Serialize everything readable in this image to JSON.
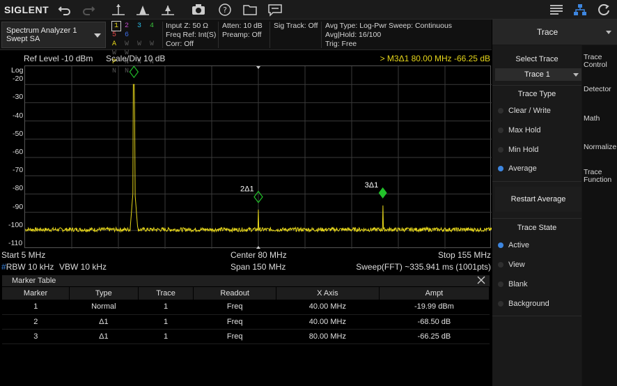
{
  "brand": "SIGLENT",
  "colors": {
    "trace": "#e5d51a",
    "marker": "#22c12a",
    "accent": "#3d86e0"
  },
  "toolbar": {
    "icons": [
      "undo-icon",
      "redo-icon",
      "marker-peak-icon",
      "marker-next-icon",
      "marker-delta-icon",
      "camera-icon",
      "help-icon",
      "folder-icon",
      "message-icon",
      "menu-icon",
      "network-icon",
      "restart-icon"
    ]
  },
  "mode": {
    "line1": "Spectrum Analyzer 1",
    "line2": "Swept SA"
  },
  "traces": {
    "numbers": [
      "1",
      "2",
      "3",
      "4",
      "5",
      "6"
    ],
    "row2": [
      "A",
      "W",
      "W",
      "W",
      "W",
      "W"
    ],
    "row3": [
      "P",
      "N",
      "N",
      "N",
      "N",
      "N"
    ]
  },
  "status": {
    "input_z": "Input Z: 50 Ω",
    "freq_ref": "Freq Ref: Int(S)",
    "corr": "Corr: Off",
    "atten": "Atten: 10 dB",
    "preamp": "Preamp: Off",
    "sig_track": "Sig Track: Off",
    "avg_type": "Avg Type: Log-Pwr",
    "avg_hold": "Avg|Hold: 16/100",
    "trig": "Trig: Free",
    "sweep": "Sweep: Continuous"
  },
  "plot": {
    "ref_level": "Ref Level  -10 dBm",
    "scale": "Scale/Div  10 dB",
    "marker_readout": "> M3Δ1   80.00 MHz  -66.25 dB",
    "y_scale_label": "Log",
    "y_ticks": [
      "-20",
      "-30",
      "-40",
      "-50",
      "-60",
      "-70",
      "-80",
      "-90",
      "-100",
      "-110"
    ],
    "start": "Start  5 MHz",
    "center": "Center  80 MHz",
    "stop": "Stop  155 MHz",
    "rbw": "RBW  10 kHz",
    "vbw": "VBW  10 kHz",
    "span": "Span  150 MHz",
    "sweep_time": "Sweep(FFT)  ~335.941 ms (1001pts)",
    "marker_labels": [
      "1",
      "2Δ1",
      "3Δ1"
    ]
  },
  "chart_data": {
    "type": "line",
    "xlabel": "",
    "ylabel": "",
    "xlim": [
      5,
      155
    ],
    "ylim": [
      -110,
      -10
    ],
    "series": [
      {
        "x": [
          5,
          38.5,
          39.5,
          40,
          40.5,
          41.5,
          80,
          80.2,
          120,
          155
        ],
        "y": [
          -99.5,
          -99,
          -80,
          -19.99,
          -80,
          -99,
          -99.5,
          -99.6,
          -99.7,
          -99.5
        ]
      }
    ],
    "markers": [
      {
        "id": "1",
        "x": 40,
        "y": -19.99
      },
      {
        "id": "2Δ1",
        "x": 80,
        "y": -88.5
      },
      {
        "id": "3Δ1",
        "x": 120,
        "y": -86.3
      }
    ],
    "noise_floor": -99.5,
    "grid": true
  },
  "marker_table": {
    "title": "Marker Table",
    "columns": [
      "Marker",
      "Type",
      "Trace",
      "Readout",
      "X Axis",
      "Ampt"
    ],
    "rows": [
      [
        "1",
        "Normal",
        "1",
        "Freq",
        "40.00 MHz",
        "-19.99 dBm"
      ],
      [
        "2",
        "Δ1",
        "1",
        "Freq",
        "40.00 MHz",
        "-68.50 dB"
      ],
      [
        "3",
        "Δ1",
        "1",
        "Freq",
        "80.00 MHz",
        "-66.25 dB"
      ]
    ]
  },
  "panel": {
    "title": "Trace",
    "select_trace_label": "Select Trace",
    "select_trace_value": "Trace 1",
    "trace_type_label": "Trace Type",
    "trace_types": [
      "Clear / Write",
      "Max Hold",
      "Min Hold",
      "Average"
    ],
    "trace_type_selected": "Average",
    "restart_average": "Restart Average",
    "trace_state_label": "Trace State",
    "trace_states": [
      "Active",
      "View",
      "Blank",
      "Background"
    ],
    "trace_state_selected": "Active",
    "tabs": [
      "Trace Control",
      "Detector",
      "Math",
      "Normalize",
      "Trace Function"
    ]
  }
}
